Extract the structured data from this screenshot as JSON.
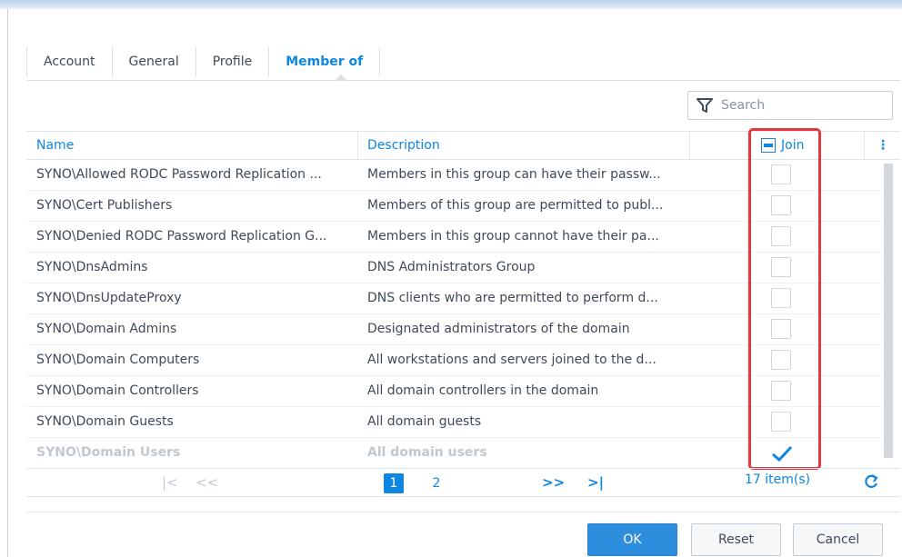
{
  "tabs": [
    {
      "label": "Account",
      "active": false
    },
    {
      "label": "General",
      "active": false
    },
    {
      "label": "Profile",
      "active": false
    },
    {
      "label": "Member of",
      "active": true
    }
  ],
  "search": {
    "placeholder": "Search",
    "icon": "filter-icon"
  },
  "table": {
    "columns": {
      "name": "Name",
      "description": "Description",
      "join": "Join"
    },
    "rows": [
      {
        "name": "SYNO\\Allowed RODC Password Replication ...",
        "description": "Members in this group can have their passw...",
        "join": false
      },
      {
        "name": "SYNO\\Cert Publishers",
        "description": "Members of this group are permitted to publ...",
        "join": false
      },
      {
        "name": "SYNO\\Denied RODC Password Replication G...",
        "description": "Members in this group cannot have their pa...",
        "join": false
      },
      {
        "name": "SYNO\\DnsAdmins",
        "description": "DNS Administrators Group",
        "join": false
      },
      {
        "name": "SYNO\\DnsUpdateProxy",
        "description": "DNS clients who are permitted to perform d...",
        "join": false
      },
      {
        "name": "SYNO\\Domain Admins",
        "description": "Designated administrators of the domain",
        "join": false
      },
      {
        "name": "SYNO\\Domain Computers",
        "description": "All workstations and servers joined to the d...",
        "join": false
      },
      {
        "name": "SYNO\\Domain Controllers",
        "description": "All domain controllers in the domain",
        "join": false
      },
      {
        "name": "SYNO\\Domain Guests",
        "description": "All domain guests",
        "join": false
      },
      {
        "name": "SYNO\\Domain Users",
        "description": "All domain users",
        "join": true,
        "disabled": true
      }
    ]
  },
  "pager": {
    "pages": [
      "1",
      "2"
    ],
    "current": "1",
    "count": "17 item(s)"
  },
  "buttons": {
    "ok": "OK",
    "reset": "Reset",
    "cancel": "Cancel"
  },
  "colors": {
    "accent": "#0f86e0",
    "highlight": "#e0393e"
  }
}
